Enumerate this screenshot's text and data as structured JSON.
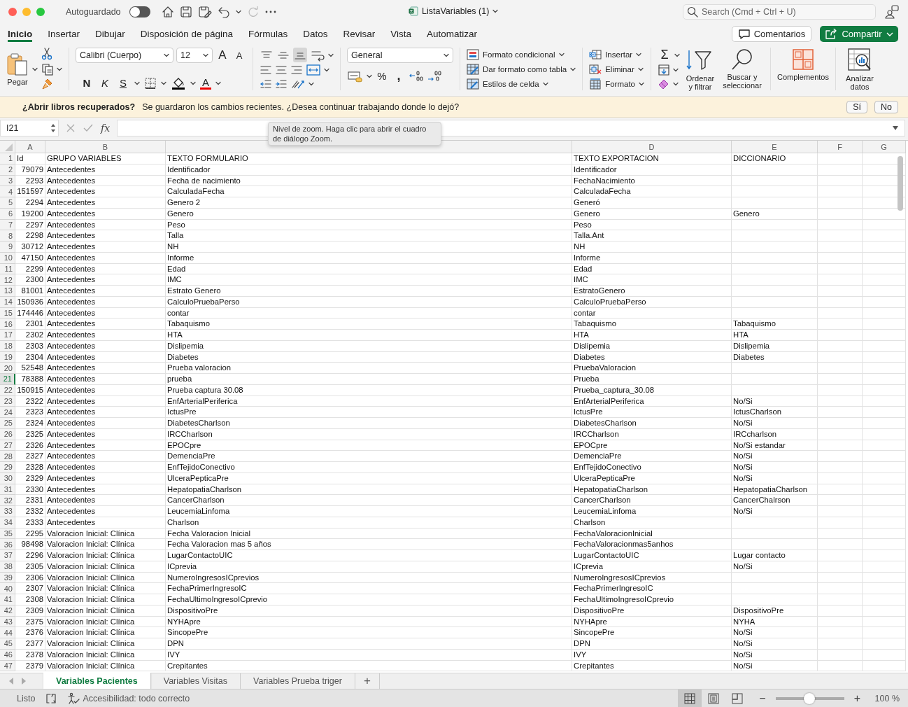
{
  "window": {
    "title": "ListaVariables (1)",
    "autosave": {
      "label": "Autoguardado",
      "on": false
    },
    "search": {
      "placeholder": "Search (Cmd + Ctrl + U)"
    }
  },
  "tabs": [
    {
      "label": "Inicio",
      "selected": true
    },
    {
      "label": "Insertar",
      "selected": false
    },
    {
      "label": "Dibujar",
      "selected": false
    },
    {
      "label": "Disposición de página",
      "selected": false
    },
    {
      "label": "Fórmulas",
      "selected": false
    },
    {
      "label": "Datos",
      "selected": false
    },
    {
      "label": "Revisar",
      "selected": false
    },
    {
      "label": "Vista",
      "selected": false
    },
    {
      "label": "Automatizar",
      "selected": false
    }
  ],
  "header_buttons": {
    "comments": "Comentarios",
    "share": "Compartir"
  },
  "ribbon": {
    "paste": "Pegar",
    "font_name": "Calibri (Cuerpo)",
    "font_size": "12",
    "grow_font": "A",
    "shrink_font": "A",
    "bold": "N",
    "italic": "K",
    "underline": "S",
    "font_color": "A",
    "vertical_align": [
      {
        "selected": false
      },
      {
        "selected": false
      },
      {
        "selected": true
      }
    ],
    "number_format": "General",
    "percent": "%",
    "thousands": ",",
    "styles": [
      "Formato condicional",
      "Dar formato como tabla",
      "Estilos de celda"
    ],
    "cells": [
      "Insertar",
      "Eliminar",
      "Formato"
    ],
    "sum": "Σ",
    "sort": "Ordenar y filtrar",
    "find": "Buscar y seleccionar",
    "add_ins": "Complementos",
    "analyze": "Analizar datos"
  },
  "recovery_bar": {
    "title": "¿Abrir libros recuperados?",
    "message": "Se guardaron los cambios recientes. ¿Desea continuar trabajando donde lo dejó?",
    "buttons": [
      "Sí",
      "No"
    ]
  },
  "formula_bar": {
    "name_box": "I21",
    "function_label": "fx",
    "tooltip": "Nivel de zoom. Haga clic para abrir el cuadro de diálogo Zoom."
  },
  "sheet": {
    "columns": [
      {
        "kind": "letter",
        "letter": "A"
      },
      {
        "kind": "letter",
        "letter": "B"
      },
      {
        "kind": "covered"
      },
      {
        "kind": "letter",
        "letter": "D"
      },
      {
        "kind": "letter",
        "letter": "E"
      },
      {
        "kind": "letter",
        "letter": "F"
      },
      {
        "kind": "letter",
        "letter": "G"
      }
    ],
    "rows": [
      {
        "n": "1",
        "kind": "labels",
        "selected": false,
        "cells": [
          "Id",
          "GRUPO VARIABLES",
          "TEXTO FORMULARIO",
          "TEXTO EXPORTACION",
          "DICCIONARIO"
        ]
      },
      {
        "n": "2",
        "kind": "record",
        "selected": false,
        "cells": [
          "79079",
          "Antecedentes",
          "Identificador",
          "Identificador"
        ]
      },
      {
        "n": "3",
        "kind": "record",
        "selected": false,
        "cells": [
          "2293",
          "Antecedentes",
          "Fecha de nacimiento",
          "FechaNacimiento"
        ]
      },
      {
        "n": "4",
        "kind": "record",
        "selected": false,
        "cells": [
          "151597",
          "Antecedentes",
          "CalculadaFecha",
          "CalculadaFecha"
        ]
      },
      {
        "n": "5",
        "kind": "record",
        "selected": false,
        "cells": [
          "2294",
          "Antecedentes",
          "Genero 2",
          "Generó"
        ]
      },
      {
        "n": "6",
        "kind": "record",
        "selected": false,
        "cells": [
          "19200",
          "Antecedentes",
          "Genero",
          "Genero",
          "Genero"
        ]
      },
      {
        "n": "7",
        "kind": "record",
        "selected": false,
        "cells": [
          "2297",
          "Antecedentes",
          "Peso",
          "Peso"
        ]
      },
      {
        "n": "8",
        "kind": "record",
        "selected": false,
        "cells": [
          "2298",
          "Antecedentes",
          "Talla",
          "Talla.Ant"
        ]
      },
      {
        "n": "9",
        "kind": "record",
        "selected": false,
        "cells": [
          "30712",
          "Antecedentes",
          "NH",
          "NH"
        ]
      },
      {
        "n": "10",
        "kind": "record",
        "selected": false,
        "cells": [
          "47150",
          "Antecedentes",
          "Informe",
          "Informe"
        ]
      },
      {
        "n": "11",
        "kind": "record",
        "selected": false,
        "cells": [
          "2299",
          "Antecedentes",
          "Edad",
          "Edad"
        ]
      },
      {
        "n": "12",
        "kind": "record",
        "selected": false,
        "cells": [
          "2300",
          "Antecedentes",
          "IMC",
          "IMC"
        ]
      },
      {
        "n": "13",
        "kind": "record",
        "selected": false,
        "cells": [
          "81001",
          "Antecedentes",
          "Estrato Genero",
          "EstratoGenero"
        ]
      },
      {
        "n": "14",
        "kind": "record",
        "selected": false,
        "cells": [
          "150936",
          "Antecedentes",
          "CalculoPruebaPerso",
          "CalculoPruebaPerso"
        ]
      },
      {
        "n": "15",
        "kind": "record",
        "selected": false,
        "cells": [
          "174446",
          "Antecedentes",
          "contar",
          "contar"
        ]
      },
      {
        "n": "16",
        "kind": "record",
        "selected": false,
        "cells": [
          "2301",
          "Antecedentes",
          "Tabaquismo",
          "Tabaquismo",
          "Tabaquismo"
        ]
      },
      {
        "n": "17",
        "kind": "record",
        "selected": false,
        "cells": [
          "2302",
          "Antecedentes",
          "HTA",
          "HTA",
          "HTA"
        ]
      },
      {
        "n": "18",
        "kind": "record",
        "selected": false,
        "cells": [
          "2303",
          "Antecedentes",
          "Dislipemia",
          "Dislipemia",
          "Dislipemia"
        ]
      },
      {
        "n": "19",
        "kind": "record",
        "selected": false,
        "cells": [
          "2304",
          "Antecedentes",
          "Diabetes",
          "Diabetes",
          "Diabetes"
        ]
      },
      {
        "n": "20",
        "kind": "record",
        "selected": false,
        "cells": [
          "52548",
          "Antecedentes",
          "Prueba valoracion",
          "PruebaValoracion"
        ]
      },
      {
        "n": "21",
        "kind": "record",
        "selected": true,
        "cells": [
          "78388",
          "Antecedentes",
          "prueba",
          "Prueba"
        ]
      },
      {
        "n": "22",
        "kind": "record",
        "selected": false,
        "cells": [
          "150915",
          "Antecedentes",
          "Prueba captura 30.08",
          "Prueba_captura_30.08"
        ]
      },
      {
        "n": "23",
        "kind": "record",
        "selected": false,
        "cells": [
          "2322",
          "Antecedentes",
          "EnfArterialPeriferica",
          "EnfArterialPeriferica",
          "No/Si"
        ]
      },
      {
        "n": "24",
        "kind": "record",
        "selected": false,
        "cells": [
          "2323",
          "Antecedentes",
          "IctusPre",
          "IctusPre",
          "IctusCharlson"
        ]
      },
      {
        "n": "25",
        "kind": "record",
        "selected": false,
        "cells": [
          "2324",
          "Antecedentes",
          "DiabetesCharlson",
          "DiabetesCharlson",
          "No/Si"
        ]
      },
      {
        "n": "26",
        "kind": "record",
        "selected": false,
        "cells": [
          "2325",
          "Antecedentes",
          "IRCCharlson",
          "IRCCharlson",
          "IRCcharlson"
        ]
      },
      {
        "n": "27",
        "kind": "record",
        "selected": false,
        "cells": [
          "2326",
          "Antecedentes",
          "EPOCpre",
          "EPOCpre",
          "No/Si estandar"
        ]
      },
      {
        "n": "28",
        "kind": "record",
        "selected": false,
        "cells": [
          "2327",
          "Antecedentes",
          "DemenciaPre",
          "DemenciaPre",
          "No/Si"
        ]
      },
      {
        "n": "29",
        "kind": "record",
        "selected": false,
        "cells": [
          "2328",
          "Antecedentes",
          "EnfTejidoConectivo",
          "EnfTejidoConectivo",
          "No/Si"
        ]
      },
      {
        "n": "30",
        "kind": "record",
        "selected": false,
        "cells": [
          "2329",
          "Antecedentes",
          "UlceraPepticaPre",
          "UlceraPepticaPre",
          "No/Si"
        ]
      },
      {
        "n": "31",
        "kind": "record",
        "selected": false,
        "cells": [
          "2330",
          "Antecedentes",
          "HepatopatiaCharlson",
          "HepatopatiaCharlson",
          "HepatopatiaCharlson"
        ]
      },
      {
        "n": "32",
        "kind": "record",
        "selected": false,
        "cells": [
          "2331",
          "Antecedentes",
          "CancerCharlson",
          "CancerCharlson",
          "CancerChalrson"
        ]
      },
      {
        "n": "33",
        "kind": "record",
        "selected": false,
        "cells": [
          "2332",
          "Antecedentes",
          "LeucemiaLinfoma",
          "LeucemiaLinfoma",
          "No/Si"
        ]
      },
      {
        "n": "34",
        "kind": "record",
        "selected": false,
        "cells": [
          "2333",
          "Antecedentes",
          "Charlson",
          "Charlson"
        ]
      },
      {
        "n": "35",
        "kind": "record",
        "selected": false,
        "cells": [
          "2295",
          "Valoracion Inicial: Clínica",
          "Fecha Valoracion Inicial",
          "FechaValoracionInicial"
        ]
      },
      {
        "n": "36",
        "kind": "record",
        "selected": false,
        "cells": [
          "98498",
          "Valoracion Inicial: Clínica",
          "Fecha Valoracion mas 5 años",
          "FechaValoracionmas5anhos"
        ]
      },
      {
        "n": "37",
        "kind": "record",
        "selected": false,
        "cells": [
          "2296",
          "Valoracion Inicial: Clínica",
          "LugarContactoUIC",
          "LugarContactoUIC",
          "Lugar contacto"
        ]
      },
      {
        "n": "38",
        "kind": "record",
        "selected": false,
        "cells": [
          "2305",
          "Valoracion Inicial: Clínica",
          "ICprevia",
          "ICprevia",
          "No/Si"
        ]
      },
      {
        "n": "39",
        "kind": "record",
        "selected": false,
        "cells": [
          "2306",
          "Valoracion Inicial: Clínica",
          "NumeroIngresosICprevios",
          "NumeroIngresosICprevios"
        ]
      },
      {
        "n": "40",
        "kind": "record",
        "selected": false,
        "cells": [
          "2307",
          "Valoracion Inicial: Clínica",
          "FechaPrimerIngresoIC",
          "FechaPrimerIngresoIC"
        ]
      },
      {
        "n": "41",
        "kind": "record",
        "selected": false,
        "cells": [
          "2308",
          "Valoracion Inicial: Clínica",
          "FechaUltimoIngresoICprevio",
          "FechaUltimoIngresoICprevio"
        ]
      },
      {
        "n": "42",
        "kind": "record",
        "selected": false,
        "cells": [
          "2309",
          "Valoracion Inicial: Clínica",
          "DispositivoPre",
          "DispositivoPre",
          "DispositivoPre"
        ]
      },
      {
        "n": "43",
        "kind": "record",
        "selected": false,
        "cells": [
          "2375",
          "Valoracion Inicial: Clínica",
          "NYHApre",
          "NYHApre",
          "NYHA"
        ]
      },
      {
        "n": "44",
        "kind": "record",
        "selected": false,
        "cells": [
          "2376",
          "Valoracion Inicial: Clínica",
          "SincopePre",
          "SincopePre",
          "No/Si"
        ]
      },
      {
        "n": "45",
        "kind": "record",
        "selected": false,
        "cells": [
          "2377",
          "Valoracion Inicial: Clínica",
          "DPN",
          "DPN",
          "No/Si"
        ]
      },
      {
        "n": "46",
        "kind": "record",
        "selected": false,
        "cells": [
          "2378",
          "Valoracion Inicial: Clínica",
          "IVY",
          "IVY",
          "No/Si"
        ]
      },
      {
        "n": "47",
        "kind": "record",
        "selected": false,
        "cells": [
          "2379",
          "Valoracion Inicial: Clínica",
          "Crepitantes",
          "Crepitantes",
          "No/Si"
        ]
      }
    ]
  },
  "sheet_tabs": [
    {
      "label": "Variables Pacientes",
      "selected": true
    },
    {
      "label": "Variables Visitas",
      "selected": false
    },
    {
      "label": "Variables Prueba triger",
      "selected": false
    }
  ],
  "add_sheet": "+",
  "status_bar": {
    "ready": "Listo",
    "accessibility": "Accesibilidad: todo correcto",
    "views": [
      {
        "selected": true
      },
      {
        "selected": false
      },
      {
        "selected": false
      }
    ],
    "zoom": {
      "minus": "−",
      "plus": "+",
      "level": 0.49,
      "reading": "100 %"
    }
  }
}
